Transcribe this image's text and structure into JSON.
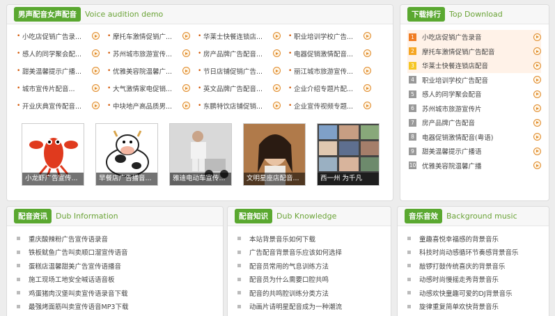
{
  "voice": {
    "tag": "男声配音女声配音",
    "subtitle": "Voice audition demo",
    "items": [
      "小吃店促销广告录...",
      "摩托车激情促销广...",
      "华莱士快餐连锁店...",
      "职业培训学校广告...",
      "感人的同学聚会配...",
      "苏州城市旅游宣传...",
      "房产品牌广告配音...",
      "电器促销激情配音...",
      "甜美温馨提示广播...",
      "优雅美容院温馨广...",
      "节日店铺促销广告...",
      "丽江城市旅游宣传...",
      "城市宣传片配音...",
      "大气激情家电促销...",
      "英文品牌广告配音...",
      "企业介绍专题片配...",
      "开业庆典宣传配音...",
      "中块地产高品质男...",
      "东鹏特饮店铺促销...",
      "企业宣传视频专题..."
    ],
    "thumbs": [
      {
        "caption": "小龙虾广告宣传...",
        "icon": "lobster-image"
      },
      {
        "caption": "早餐店广告播音...",
        "icon": "cow-cartoon-image"
      },
      {
        "caption": "雅迪电动车宣传...",
        "icon": "man-on-scooter-image"
      },
      {
        "caption": "文明星座店配音...",
        "icon": "woman-portrait-image"
      },
      {
        "caption": "西一州 为千凡",
        "icon": "photo-collage-image"
      }
    ]
  },
  "download": {
    "tag": "下载排行",
    "subtitle": "Top Download",
    "items": [
      {
        "rank": "1",
        "label": "小吃店促销广告录音"
      },
      {
        "rank": "2",
        "label": "摩托车激情促销广告配音"
      },
      {
        "rank": "3",
        "label": "华莱士快餐连锁店配音"
      },
      {
        "rank": "4",
        "label": "职业培训学校广告配音"
      },
      {
        "rank": "5",
        "label": "感人的同学聚会配音"
      },
      {
        "rank": "6",
        "label": "苏州城市旅游宣传片"
      },
      {
        "rank": "7",
        "label": "房产品牌广告配音"
      },
      {
        "rank": "8",
        "label": "电器促销激情配音(粤语)"
      },
      {
        "rank": "9",
        "label": "甜美温馨提示广播语"
      },
      {
        "rank": "10",
        "label": "优雅美容院温馨广播"
      }
    ],
    "rank_colors": [
      "#f07d24",
      "#f5a623",
      "#f5c623",
      "#999999"
    ]
  },
  "news": {
    "tag": "配音资讯",
    "subtitle": "Dub Information",
    "items": [
      "重庆酸辣粉广告宣传语录音",
      "铁板鱿鱼广告叫卖顺口溜宣传语音",
      "蛋糕店温馨甜美广告宣传语播音",
      "施工现场工地安全喊话语音板",
      "鸡蛋猪肉汉堡叫卖宣传语录音下载",
      "最强烤面筋叫卖宣传语音MP3下载"
    ]
  },
  "knowledge": {
    "tag": "配音知识",
    "subtitle": "Dub Knowledge",
    "items": [
      "本站背景音乐如何下载",
      "广告配音背景音乐应该如何选择",
      "配音员常用的气息训练方法",
      "配音员为什么需要口腔共鸣",
      "配音的共鸣腔训练分类方法",
      "动画片请明星配音成为一种潮流"
    ]
  },
  "music": {
    "tag": "音乐音效",
    "subtitle": "Background music",
    "items": [
      "童趣喜悦幸福感的背景音乐",
      "科技时尚动感循环节奏感背景音乐",
      "敲锣打鼓传统喜庆的背景音乐",
      "动感时尚慢摇走秀背景音乐",
      "动感欢快童趣可爱的DJ背景音乐",
      "旋律重复简单欢快背景音乐"
    ]
  }
}
